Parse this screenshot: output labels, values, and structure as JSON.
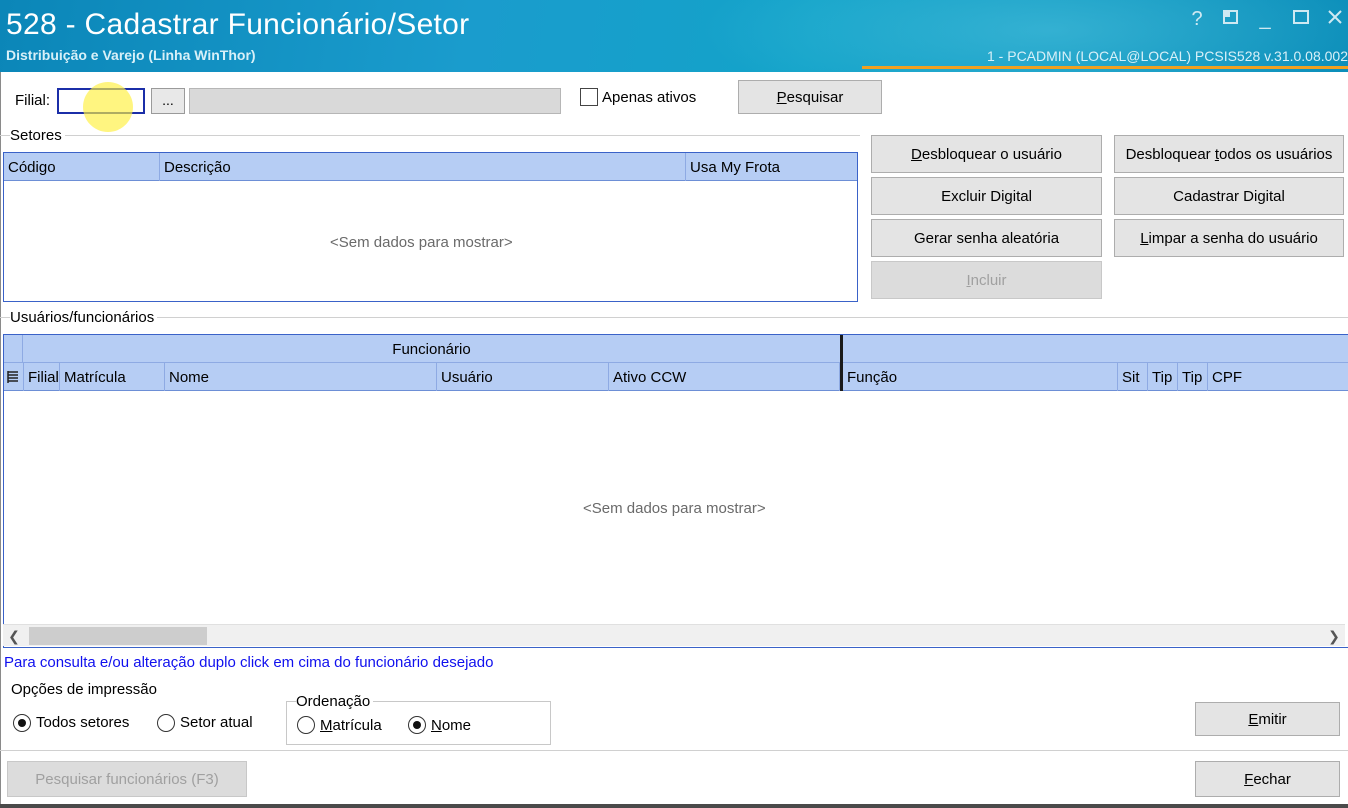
{
  "window": {
    "title": "528 - Cadastrar Funcionário/Setor",
    "subtitle": "Distribuição e Varejo (Linha WinThor)",
    "session": "1 - PCADMIN (LOCAL@LOCAL)   PCSIS528  v.31.0.08.002",
    "controls": {
      "help": "?",
      "min": "_"
    }
  },
  "filter": {
    "filial_label": "Filial:",
    "filial_value": "",
    "ellipsis_label": "...",
    "apenas_ativos_label": "Apenas ativos",
    "pesquisar_prefix": "",
    "pesquisar_key": "P",
    "pesquisar_rest": "esquisar"
  },
  "setores": {
    "title": "Setores",
    "columns": [
      "Código",
      "Descrição",
      "Usa My Frota"
    ],
    "empty": "<Sem dados para mostrar>"
  },
  "actions": {
    "desbloquear_usuario": {
      "key": "D",
      "rest": "esbloquear o usuário"
    },
    "desbloquear_todos": {
      "pre": "Desbloquear ",
      "key": "t",
      "rest": "odos os usuários"
    },
    "excluir_digital": "Excluir Digital",
    "cadastrar_digital": "Cadastrar Digital",
    "gerar_senha": "Gerar senha aleatória",
    "limpar_senha": {
      "key": "L",
      "rest": "impar a senha do usuário"
    },
    "incluir": {
      "key": "I",
      "rest": "ncluir"
    }
  },
  "usuarios": {
    "title": "Usuários/funcionários",
    "band": "Funcionário",
    "columns": [
      "Filial",
      "Matrícula",
      "Nome",
      "Usuário",
      "Ativo CCW",
      "Função",
      "Sit",
      "Tip",
      "Tip",
      "CPF"
    ],
    "empty": "<Sem dados para mostrar>"
  },
  "hint": "Para consulta e/ou alteração duplo click em cima do funcionário desejado",
  "impressao": {
    "title": "Opções de impressão",
    "todos_setores": "Todos setores",
    "setor_atual": "Setor atual",
    "selected": "todos_setores"
  },
  "ordenacao": {
    "title": "Ordenação",
    "matricula": {
      "key": "M",
      "rest": "atrícula"
    },
    "nome": {
      "key": "N",
      "rest": "ome"
    },
    "selected": "nome"
  },
  "footer": {
    "pesquisar_funcionarios": "Pesquisar funcionários (F3)",
    "emitir": {
      "key": "E",
      "rest": "mitir"
    },
    "fechar": {
      "key": "F",
      "rest": "echar"
    }
  }
}
